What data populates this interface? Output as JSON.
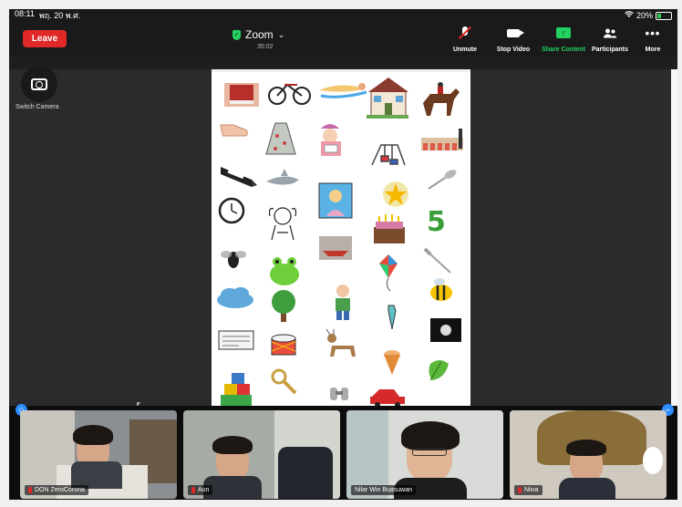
{
  "status_bar": {
    "time": "08:11",
    "date": "พฤ. 20 พ.ศ.",
    "wifi_icon": "wifi-icon",
    "battery": "20%"
  },
  "toolbar": {
    "leave_label": "Leave",
    "meeting_title": "Zoom",
    "timer": "35:02",
    "unmute_label": "Unmute",
    "stop_video_label": "Stop Video",
    "share_content_label": "Share Content",
    "participants_label": "Participants",
    "more_label": "More"
  },
  "switch_camera_label": "Switch Camera",
  "participants": [
    {
      "name": "DON ZeroCorona"
    },
    {
      "name": "Aun"
    },
    {
      "name": "Nilar Win Buasuwan"
    },
    {
      "name": "Niiva"
    }
  ],
  "shared_content": {
    "items": [
      "book-picture",
      "bicycle-picture",
      "swimmer-picture",
      "house-picture",
      "horse-rider-picture",
      "foot-picture",
      "dress-picture",
      "girl-reading-picture",
      "swing-picture",
      "children-picture",
      "crayon-picture",
      "shark-picture",
      "girl-in-frame-picture",
      "star-picture",
      "spoon-picture",
      "clock-picture",
      "crying-boy-picture",
      "cake-picture",
      "number-five-picture",
      "fly-picture",
      "frog-picture",
      "boat-picture",
      "kite-picture",
      "fork-picture",
      "cloud-picture",
      "tree-picture",
      "boy-picture",
      "tie-picture",
      "bee-picture",
      "newspaper-picture",
      "drum-picture",
      "goat-picture",
      "ice-cream-picture",
      "moon-picture",
      "blocks-picture",
      "magnifier-picture",
      "binoculars-picture",
      "car-picture",
      "leaf-picture"
    ],
    "number_glyph": "5"
  },
  "colors": {
    "leave": "#e02828",
    "accent_green": "#23d160",
    "zoom_blue": "#2d8cff"
  }
}
